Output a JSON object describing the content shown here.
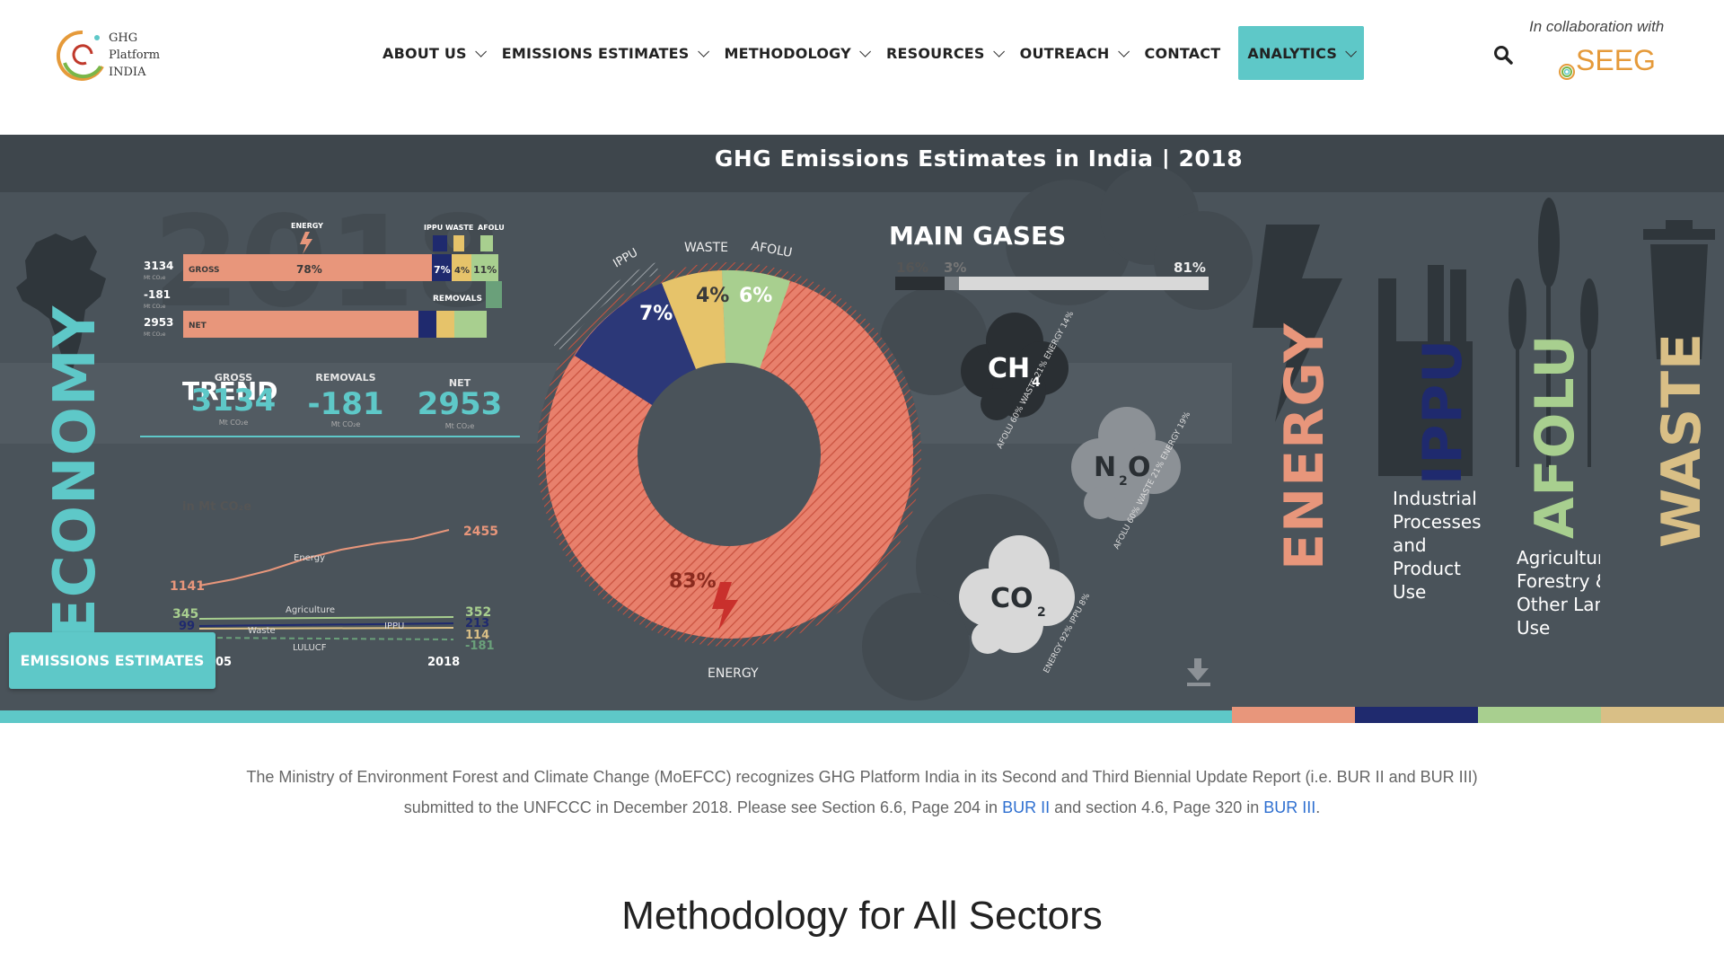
{
  "logo": {
    "line1": "GHG",
    "line2": "Platform",
    "line3": "INDIA"
  },
  "nav": {
    "items": [
      {
        "label": "ABOUT US"
      },
      {
        "label": "EMISSIONS ESTIMATES"
      },
      {
        "label": "METHODOLOGY"
      },
      {
        "label": "RESOURCES"
      },
      {
        "label": "OUTREACH"
      },
      {
        "label": "CONTACT"
      },
      {
        "label": "ANALYTICS"
      }
    ]
  },
  "collab": {
    "text": "In collaboration with",
    "partner": "SEEG"
  },
  "banner": {
    "title": "GHG Emissions Estimates in India | 2018",
    "year_watermark": "2018",
    "economy_label": "ECONOMY",
    "sector_icons": [
      "ENERGY",
      "IPPU",
      "WASTE",
      "AFOLU"
    ],
    "rows": {
      "gross": {
        "value": "3134",
        "unit": "Mt CO₂e",
        "label": "GROSS",
        "energy_pct": "78%",
        "ippu_pct": "7%",
        "waste_pct": "4%",
        "afolu_pct": "11%"
      },
      "removals": {
        "value": "-181",
        "unit": "Mt CO₂e",
        "label": "REMOVALS"
      },
      "net": {
        "value": "2953",
        "unit": "Mt CO₂e",
        "label": "NET"
      }
    },
    "stats": {
      "gross_label": "GROSS",
      "gross_value": "3134",
      "removals_label": "REMOVALS",
      "removals_value": "-181",
      "net_label": "NET",
      "net_value": "2953",
      "unit": "Mt CO₂e"
    },
    "trend": {
      "title": "TREND",
      "subtitle": "in Mt CO₂e",
      "x_start": "2005",
      "x_start_visible": "05",
      "x_end": "2018",
      "labels": {
        "energy": "Energy",
        "agriculture": "Agriculture",
        "waste": "Waste",
        "ippu": "IPPU",
        "lulucf": "LULUCF"
      },
      "start_values": {
        "energy": "1141",
        "agriculture": "345",
        "ippu": "99"
      },
      "end_values": {
        "energy": "2455",
        "agriculture": "352",
        "ippu": "213",
        "waste": "114",
        "lulucf": "-181"
      }
    },
    "donut": {
      "labels": {
        "ippu": "IPPU",
        "waste": "WASTE",
        "afolu": "AFOLU",
        "energy": "ENERGY"
      },
      "pct": {
        "ippu": "7%",
        "waste": "4%",
        "afolu": "6%",
        "energy": "83%"
      }
    },
    "gases": {
      "title": "MAIN GASES",
      "pct": {
        "a": "16%",
        "b": "3%",
        "c": "81%"
      },
      "ch4": {
        "label": "CH",
        "sub": "4",
        "ring": "AFOLU 60% WASTE 21% ENERGY 14%"
      },
      "n2o": {
        "label": "N",
        "sub": "2",
        "tail": "O",
        "ring": "AFOLU 60% WASTE 21% ENERGY 19%"
      },
      "co2": {
        "label": "CO",
        "sub": "2",
        "ring": "ENERGY 92% IPPU 8%"
      }
    },
    "sectors": {
      "energy": "ENERGY",
      "ippu": "IPPU",
      "ippu_desc": [
        "Industrial",
        "Processes",
        "and",
        "Product",
        "Use"
      ],
      "afolu": "AFOLU",
      "afolu_desc": [
        "Agriculture",
        "Forestry &",
        "Other Land",
        "Use"
      ],
      "waste": "WASTE"
    },
    "colors": {
      "energy": "#e8967b",
      "ippu": "#1f2a6e",
      "afolu": "#a8cf8f",
      "waste": "#d9bf86",
      "teal": "#5ec8c8"
    }
  },
  "emissions_button": "EMISSIONS ESTIMATES",
  "notice": {
    "part1": "The Ministry of Environment Forest and Climate Change (MoEFCC) recognizes GHG Platform India in its Second and Third Biennial Update Report (i.e. BUR II and BUR III) submitted to the UNFCCC in December 2018. Please see Section 6.6, Page 204 in ",
    "link1": "BUR II",
    "part2": " and section 4.6, Page 320 in ",
    "link2": "BUR III",
    "part3": "."
  },
  "heading": "Methodology for All Sectors"
}
